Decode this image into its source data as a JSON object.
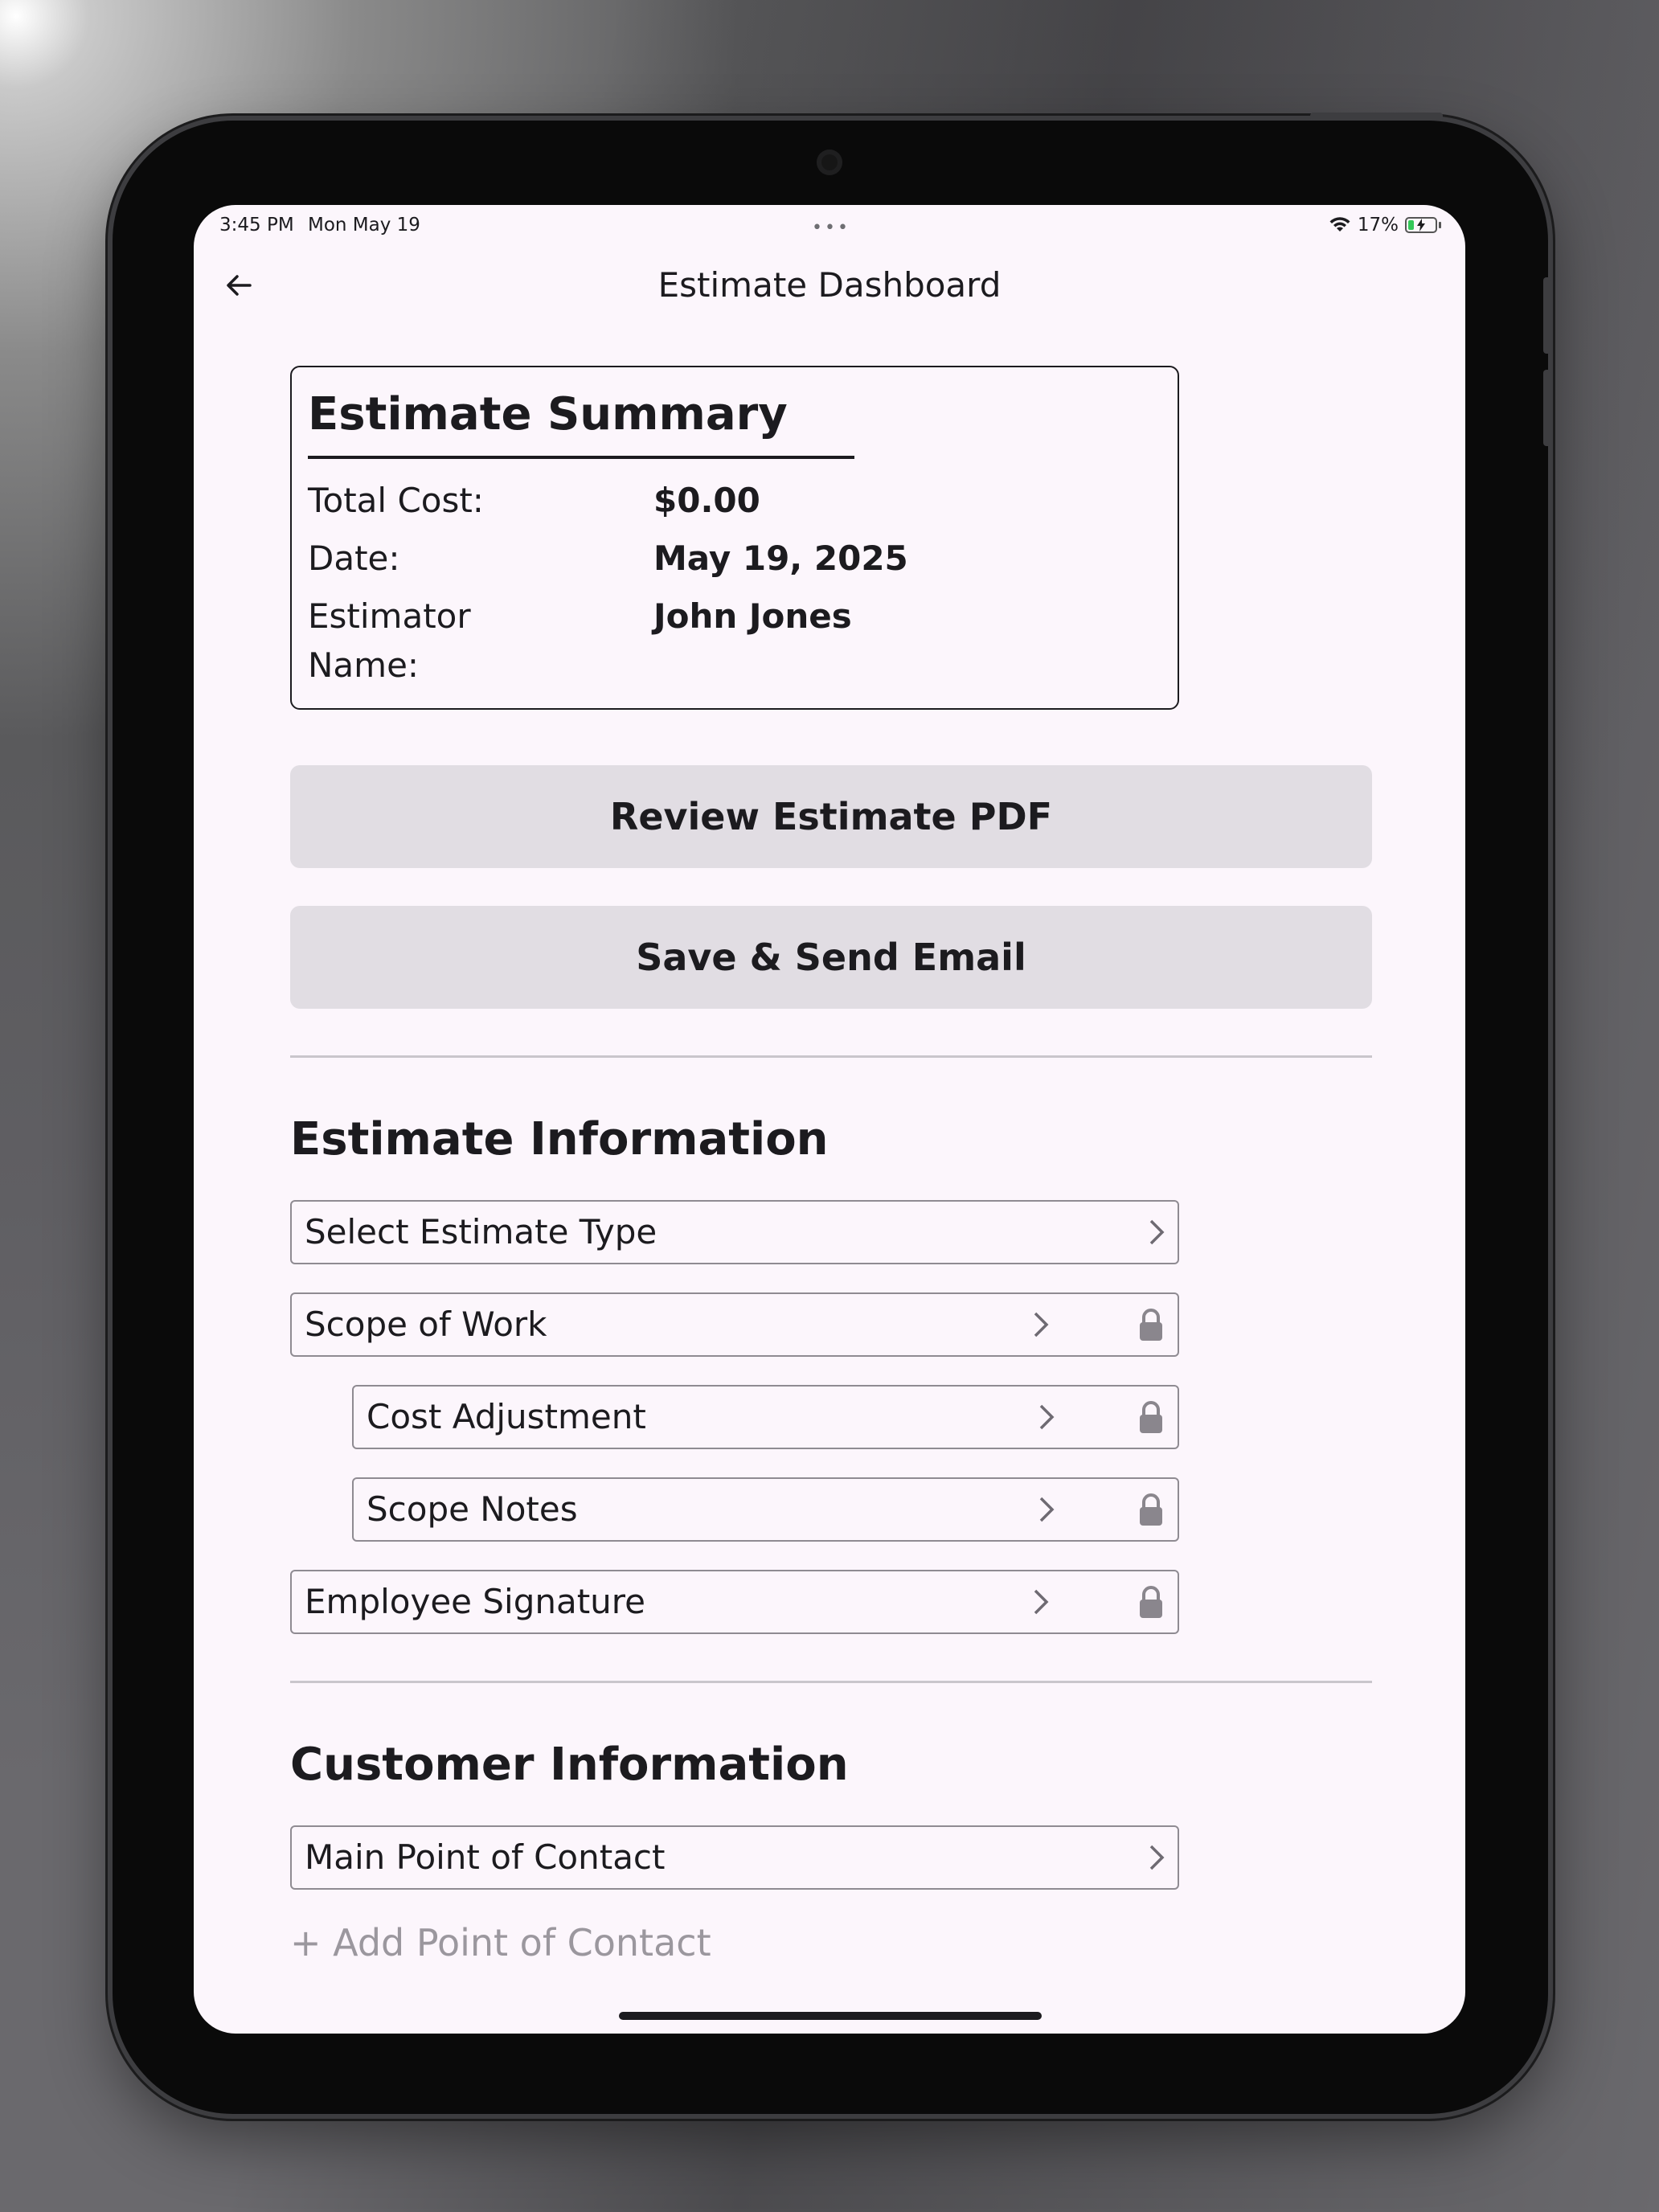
{
  "status_bar": {
    "time": "3:45 PM",
    "date": "Mon May 19",
    "dots": "•••",
    "battery": "17%"
  },
  "nav": {
    "title": "Estimate Dashboard",
    "back_icon": "arrow-left-icon"
  },
  "summary": {
    "title": "Estimate Summary",
    "rows": [
      {
        "label": "Total Cost:",
        "value": "$0.00"
      },
      {
        "label": "Date:",
        "value": "May 19, 2025"
      },
      {
        "label": "Estimator",
        "label2": "Name:",
        "value": "John Jones"
      }
    ]
  },
  "actions": {
    "review_pdf": "Review Estimate PDF",
    "save_send": "Save & Send Email"
  },
  "estimate_info": {
    "title": "Estimate Information",
    "items": [
      {
        "label": "Select Estimate Type",
        "locked": false
      },
      {
        "label": "Scope of Work",
        "locked": true
      },
      {
        "label": "Cost Adjustment",
        "locked": true
      },
      {
        "label": "Scope Notes",
        "locked": true
      },
      {
        "label": "Employee Signature",
        "locked": true
      }
    ]
  },
  "customer_info": {
    "title": "Customer Information",
    "items": [
      {
        "label": "Main Point of Contact",
        "locked": false
      }
    ],
    "add_link": "+ Add Point of Contact"
  },
  "colors": {
    "screen_bg": "#fcf6fc",
    "button_bg": "#e1dde3",
    "text": "#1c1b1f",
    "muted": "#9b979e",
    "border": "#8f8b92",
    "battery_green": "#34c759"
  }
}
